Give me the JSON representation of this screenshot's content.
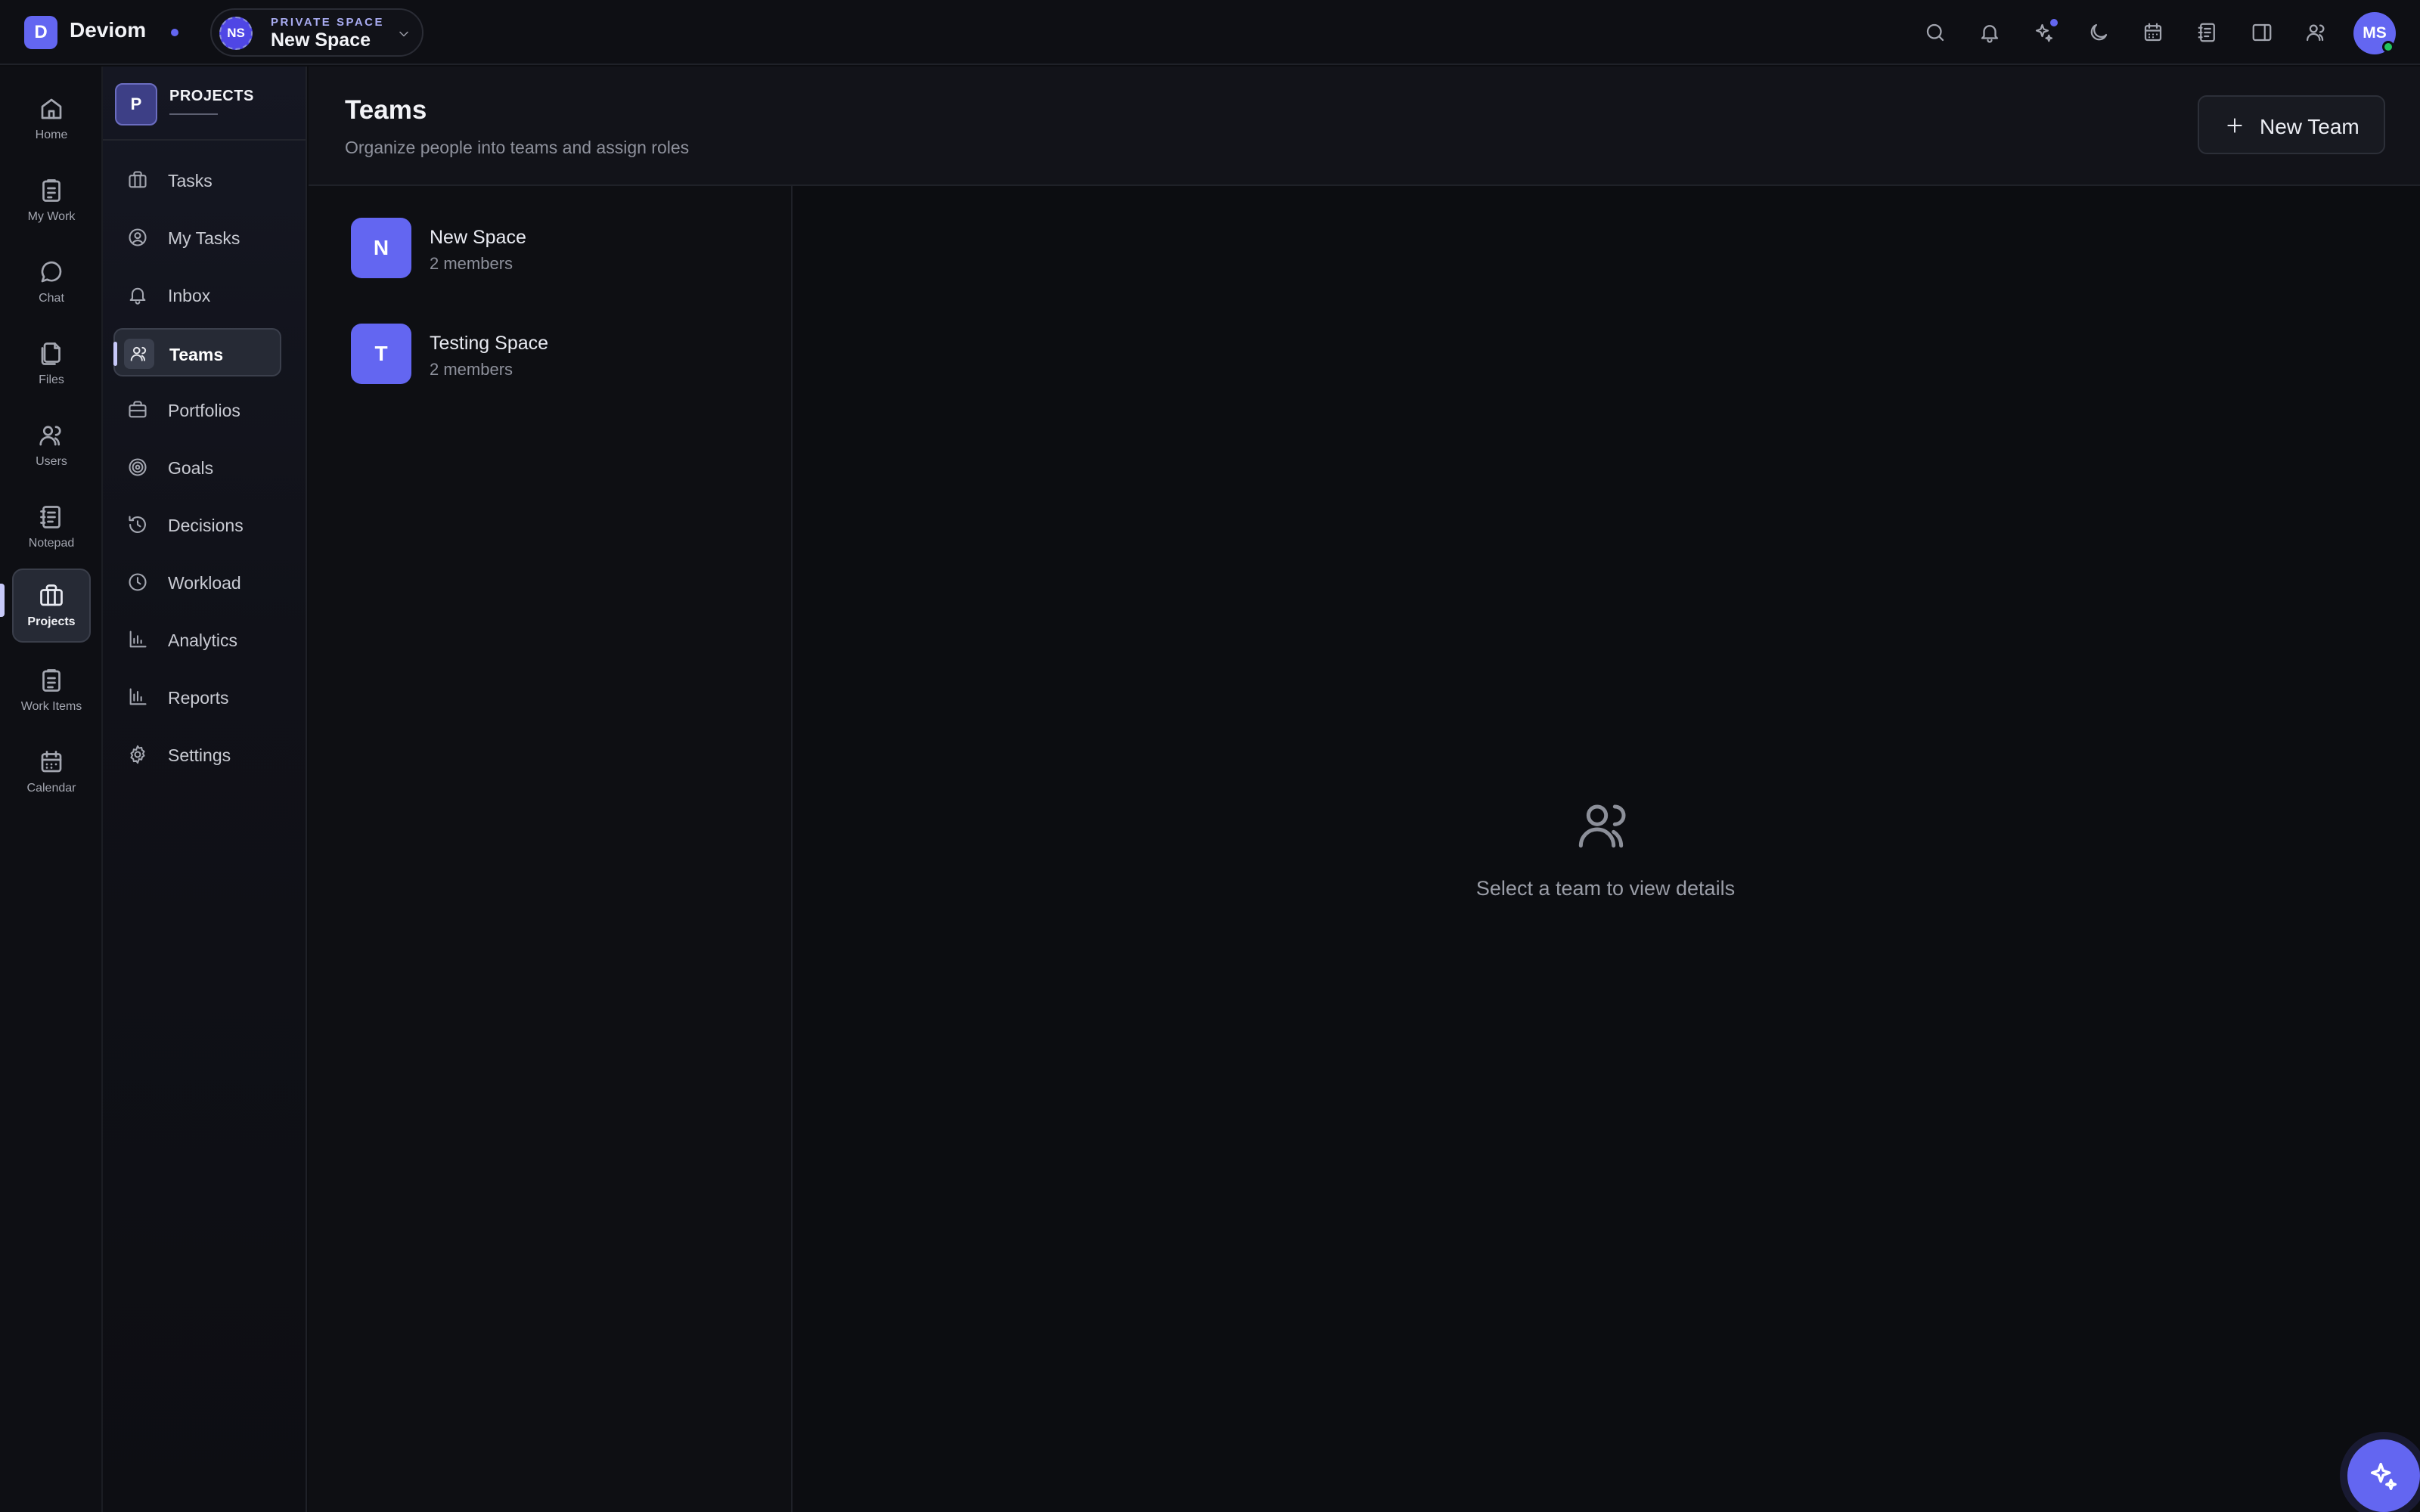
{
  "app": {
    "logo_letter": "D",
    "brand": "Deviom"
  },
  "space_switcher": {
    "initials": "NS",
    "kicker": "PRIVATE SPACE",
    "name": "New Space"
  },
  "user": {
    "initials": "MS"
  },
  "rail": {
    "items": [
      {
        "label": "Home"
      },
      {
        "label": "My Work"
      },
      {
        "label": "Chat"
      },
      {
        "label": "Files"
      },
      {
        "label": "Users"
      },
      {
        "label": "Notepad"
      },
      {
        "label": "Projects"
      },
      {
        "label": "Work Items"
      },
      {
        "label": "Calendar"
      }
    ]
  },
  "subnav": {
    "badge": "P",
    "title": "PROJECTS",
    "items": [
      {
        "label": "Tasks"
      },
      {
        "label": "My Tasks"
      },
      {
        "label": "Inbox"
      },
      {
        "label": "Teams"
      },
      {
        "label": "Portfolios"
      },
      {
        "label": "Goals"
      },
      {
        "label": "Decisions"
      },
      {
        "label": "Workload"
      },
      {
        "label": "Analytics"
      },
      {
        "label": "Reports"
      },
      {
        "label": "Settings"
      }
    ]
  },
  "page": {
    "title": "Teams",
    "subtitle": "Organize people into teams and assign roles",
    "new_team_label": "New Team"
  },
  "teams": [
    {
      "initial": "N",
      "name": "New Space",
      "meta": "2 members"
    },
    {
      "initial": "T",
      "name": "Testing Space",
      "meta": "2 members"
    }
  ],
  "empty_state": {
    "text": "Select a team to view details"
  },
  "colors": {
    "accent": "#6366f1",
    "online": "#22c55e",
    "background": "#0c0d11"
  }
}
